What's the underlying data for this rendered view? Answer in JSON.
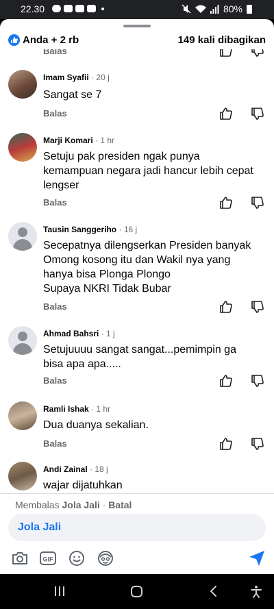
{
  "status_bar": {
    "time": "22.30",
    "battery": "80%",
    "icons": [
      "cloud-icon",
      "gmail-icon",
      "check-icon",
      "youtube-icon",
      "dot-icon",
      "mute-icon",
      "wifi-icon",
      "signal-icon",
      "battery-icon"
    ]
  },
  "header": {
    "reactions": "Anda + 2 rb",
    "shares": "149 kali dibagikan"
  },
  "partial_row": {
    "reply": "Balas"
  },
  "comments": [
    {
      "name": "Imam Syafii",
      "separator": "·",
      "age": "20 j",
      "lines": [
        "Sangat se 7"
      ],
      "reply": "Balas",
      "avatar": "photo"
    },
    {
      "name": "Marji Komari",
      "separator": "·",
      "age": "1 hr",
      "lines": [
        "Setuju pak presiden ngak punya",
        "kemampuan negara jadi hancur lebih cepat",
        "lengser"
      ],
      "reply": "Balas",
      "avatar": "photo2"
    },
    {
      "name": "Tausin Sanggeriho",
      "separator": "·",
      "age": "16 j",
      "lines": [
        "Secepatnya dilengserkan Presiden banyak",
        "Omong kosong itu dan Wakil nya yang",
        "hanya bisa Plonga Plongo",
        "Supaya NKRI Tidak Bubar"
      ],
      "reply": "Balas",
      "avatar": "default"
    },
    {
      "name": "Ahmad Bahsri",
      "separator": "·",
      "age": "1 j",
      "lines": [
        "Setujuuuu sangat sangat...pemimpin ga",
        "bisa apa apa....."
      ],
      "reply": "Balas",
      "avatar": "default"
    },
    {
      "name": "Ramli Ishak",
      "separator": "·",
      "age": "1 hr",
      "lines": [
        "Dua duanya sekalian."
      ],
      "reply": "Balas",
      "avatar": "photo3"
    },
    {
      "name": "Andi Zainal",
      "separator": "·",
      "age": "18 j",
      "lines": [
        "wajar dijatuhkan"
      ],
      "reply": "Balas",
      "avatar": "photo4"
    }
  ],
  "reply_bar": {
    "prefix": "Membalas",
    "name": "Jola Jali",
    "separator": "·",
    "cancel": "Batal"
  },
  "composer": {
    "mention": "Jola Jali",
    "tools": [
      "camera-icon",
      "gif-icon",
      "emoji-icon",
      "avatar-sticker-icon",
      "send-icon"
    ],
    "gif_label": "GIF"
  },
  "nav": [
    "recent-apps-icon",
    "home-icon",
    "back-icon",
    "accessibility-icon"
  ]
}
